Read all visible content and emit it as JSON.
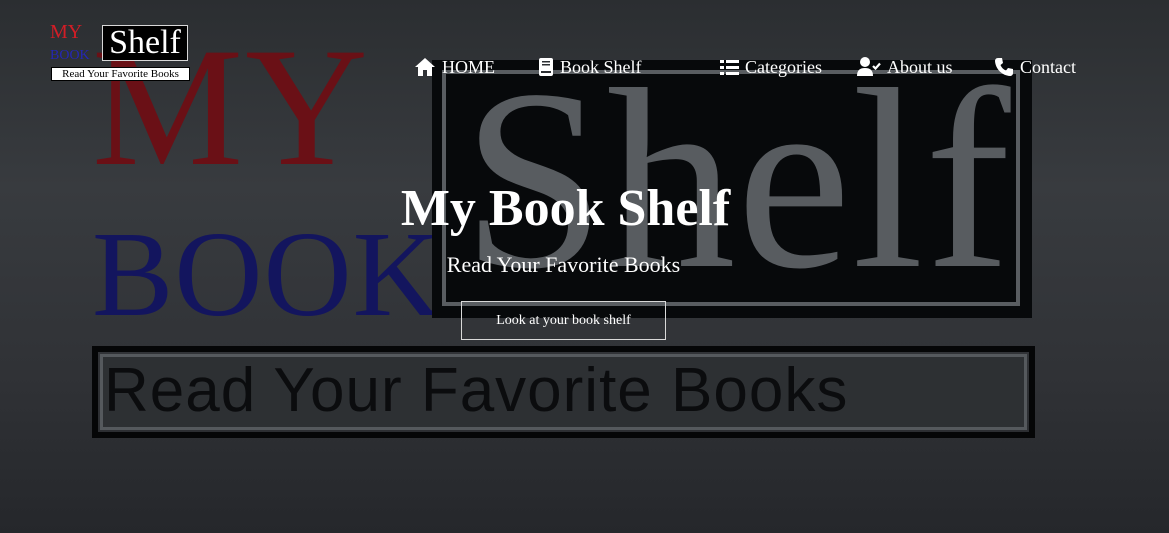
{
  "logo": {
    "my": "MY",
    "book": "BOOK",
    "shelf": "Shelf",
    "tagline": "Read Your Favorite Books"
  },
  "background_art": {
    "my": "MY",
    "book": "BOOK",
    "shelf": "Shelf",
    "tagline": "Read Your Favorite Books"
  },
  "nav": {
    "items": [
      {
        "label": "HOME",
        "icon": "home-icon"
      },
      {
        "label": "Book Shelf",
        "icon": "book-icon"
      },
      {
        "label": "Categories",
        "icon": "list-icon"
      },
      {
        "label": "About us",
        "icon": "user-check-icon"
      },
      {
        "label": "Contact",
        "icon": "phone-icon"
      }
    ]
  },
  "hero": {
    "title": "My Book Shelf",
    "subtitle": "Read Your Favorite Books",
    "cta_label": "Look at your book shelf"
  },
  "colors": {
    "logo_my": "#d21d26",
    "logo_book": "#2427b5",
    "text": "#ffffff",
    "background": "#2c2f33"
  }
}
